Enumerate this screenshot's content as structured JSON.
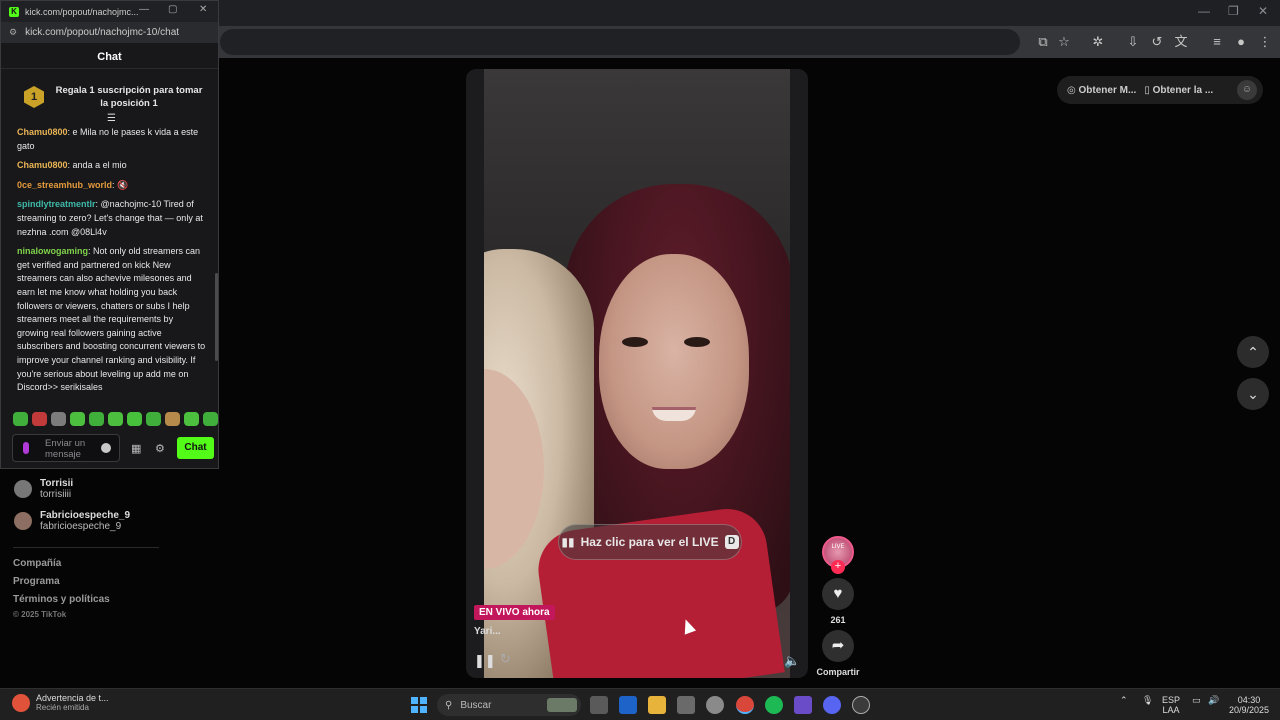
{
  "browser": {
    "url": "kick.com/popout/nachojmc-10/chat"
  },
  "page": {
    "top_right": {
      "btn1": "Obtener M...",
      "btn2": "Obtener la ..."
    },
    "live": {
      "cta": "Haz clic para ver el LIVE",
      "cta_key": "D",
      "badge": "EN VIVO ahora",
      "username": "Yari...",
      "like_count": "261",
      "share_label": "Compartir",
      "avatar_badge": "LIVE"
    },
    "sidebar": {
      "following": [
        {
          "name": "Torrisii",
          "handle": "torrisiiii"
        },
        {
          "name": "Fabricioespeche_9",
          "handle": "fabricioespeche_9"
        }
      ],
      "links": [
        "Compañía",
        "Programa",
        "Términos y políticas"
      ],
      "copyright": "© 2025 TikTok"
    }
  },
  "popout": {
    "title": "kick.com/popout/nachojmc...",
    "url": "kick.com/popout/nachojmc-10/chat",
    "header": "Chat",
    "pinned": {
      "badge": "1",
      "text": "Regala 1 suscripción para tomar la posición 1"
    },
    "messages": [
      {
        "user": "Chamu0800",
        "color": "#e9b454",
        "text": "e Mila no le pases k vida a este gato"
      },
      {
        "user": "Chamu0800",
        "color": "#e9b454",
        "text": "anda a el mio"
      },
      {
        "user": "0ce_streamhub_world",
        "color": "#e39a3b",
        "text": ""
      },
      {
        "user": "spindlytreatmentlr",
        "color": "#3fb9a8",
        "text": "@nachojmc-10 Tired of streaming to zero? Let's change that — only at nezhna .com @08Ll4v"
      },
      {
        "user": "ninalowogaming",
        "color": "#7fd14a",
        "text": "Not only old streamers can get verified and partnered on kick New streamers can also achevive milesones and earn let me know what holding you back followers or viewers, chatters or subs I help streamers meet all the requirements by growing real followers gaining active subscribers and boosting concurrent viewers to improve your channel ranking and visibility. If you're serious about leveling up add me on Discord>> serikisales"
      }
    ],
    "input_placeholder": "Enviar un mensaje",
    "send_label": "Chat"
  },
  "taskbar": {
    "notif_title": "Advertencia de t...",
    "notif_sub": "Recién emitida",
    "search_placeholder": "Buscar",
    "lang1": "ESP",
    "lang2": "LAA",
    "time": "04:30",
    "date": "20/9/2025"
  }
}
